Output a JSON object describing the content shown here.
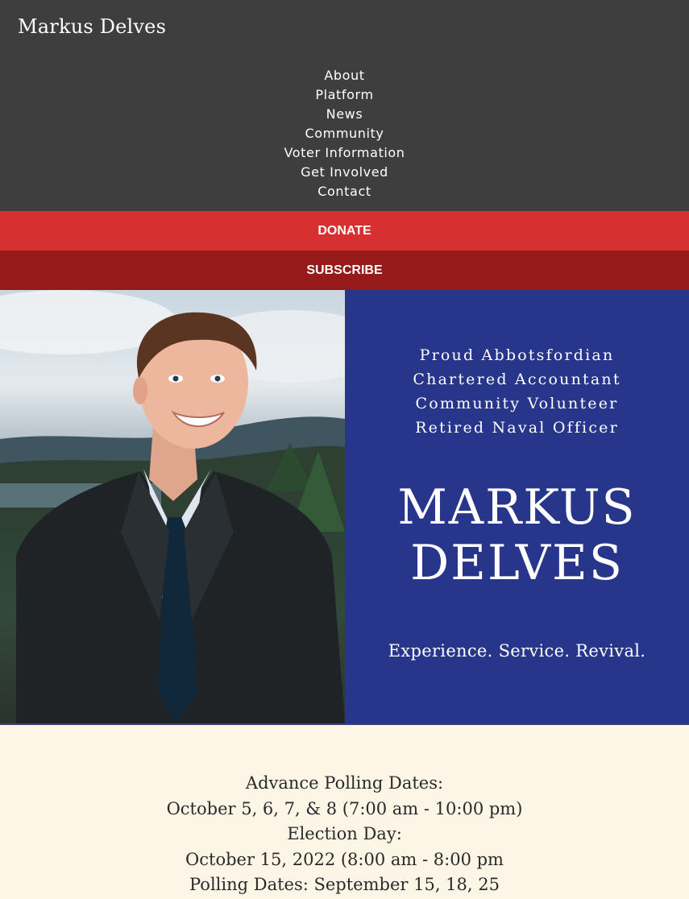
{
  "site_title": "Markus Delves",
  "nav": [
    "About",
    "Platform",
    "News",
    "Community",
    "Voter Information",
    "Get Involved",
    "Contact"
  ],
  "buttons": {
    "donate": "DONATE",
    "subscribe": "SUBSCRIBE"
  },
  "hero": {
    "taglines": [
      "Proud Abbotsfordian",
      "Chartered Accountant",
      "Community Volunteer",
      "Retired Naval Officer"
    ],
    "name_line1": "MARKUS",
    "name_line2": "DELVES",
    "slogan": "Experience. Service. Revival."
  },
  "info": {
    "lines": [
      "Advance Polling Dates:",
      "October 5, 6, 7, & 8 (7:00 am - 10:00 pm)",
      "Election Day:",
      "October 15, 2022 (8:00 am - 8:00 pm",
      "Polling Dates: September 15, 18, 25"
    ]
  },
  "colors": {
    "header_bg": "#3e3e3e",
    "donate_bg": "#d63031",
    "subscribe_bg": "#971a1a",
    "hero_panel_bg": "#27358a",
    "info_bg": "#fdf6e6"
  }
}
